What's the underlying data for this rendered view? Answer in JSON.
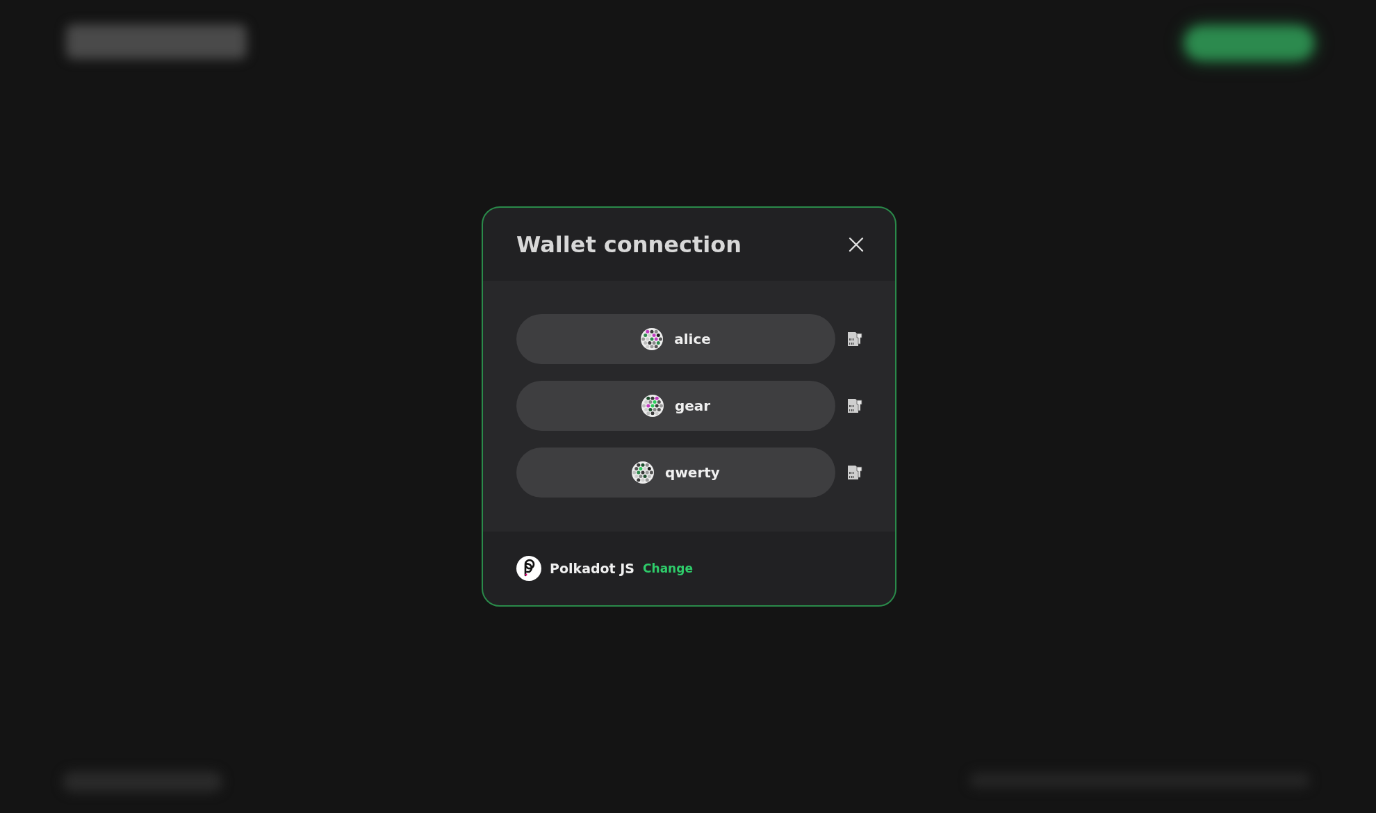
{
  "modal": {
    "title": "Wallet connection",
    "accounts": [
      {
        "name": "alice"
      },
      {
        "name": "gear"
      },
      {
        "name": "qwerty"
      }
    ],
    "footer": {
      "wallet_name": "Polkadot JS",
      "change_label": "Change"
    }
  }
}
